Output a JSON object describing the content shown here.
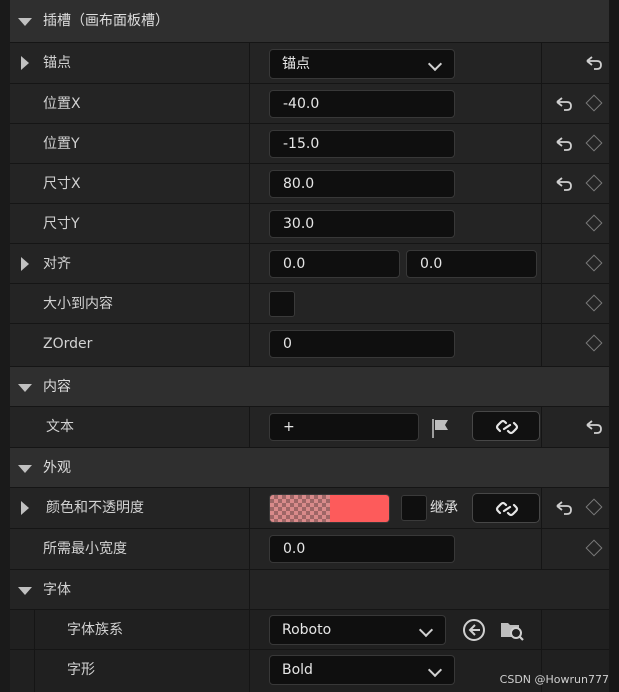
{
  "sections": {
    "slot": "插槽（画布面板槽）",
    "content": "内容",
    "appearance": "外观",
    "font": "字体"
  },
  "rows": {
    "anchor": {
      "label": "锚点",
      "value": "锚点"
    },
    "pos_x": {
      "label": "位置X",
      "value": "-40.0"
    },
    "pos_y": {
      "label": "位置Y",
      "value": "-15.0"
    },
    "size_x": {
      "label": "尺寸X",
      "value": "80.0"
    },
    "size_y": {
      "label": "尺寸Y",
      "value": "30.0"
    },
    "alignment": {
      "label": "对齐",
      "value_x": "0.0",
      "value_y": "0.0"
    },
    "size_to_content": {
      "label": "大小到内容",
      "checked": false
    },
    "zorder": {
      "label": "ZOrder",
      "value": "0"
    },
    "text": {
      "label": "文本",
      "value": "+"
    },
    "color": {
      "label": "颜色和不透明度",
      "inherit_label": "继承",
      "swatch_color": "#fd5b5b",
      "alpha": 0.5
    },
    "min_width": {
      "label": "所需最小宽度",
      "value": "0.0"
    },
    "font_family": {
      "label": "字体族系",
      "value": "Roboto"
    },
    "typeface": {
      "label": "字形",
      "value": "Bold"
    }
  },
  "watermark": "CSDN @Howrun777",
  "icons": {
    "reset": "reset-arrow-icon",
    "keyframe": "keyframe-diamond-icon",
    "link": "link-icon",
    "flag": "flag-icon",
    "browse": "browse-back-icon",
    "find": "find-in-folder-icon"
  }
}
